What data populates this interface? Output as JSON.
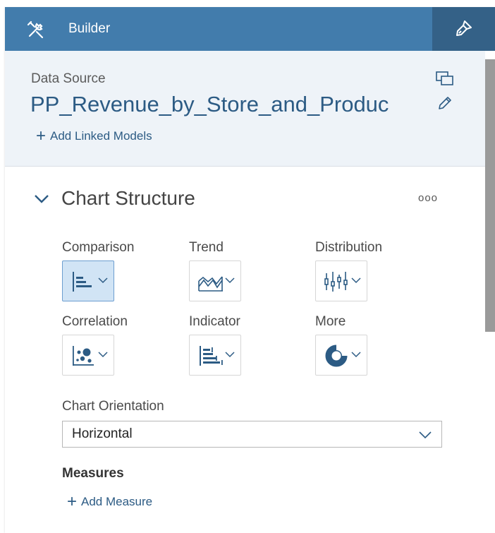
{
  "header": {
    "title": "Builder",
    "builder_icon": "tools-icon",
    "styling_icon": "paintbrush-icon",
    "color": "#427cac",
    "active_tab_color": "#346187"
  },
  "data_source": {
    "label": "Data Source",
    "name": "PP_Revenue_by_Store_and_Produc",
    "add_linked_label": "Add Linked Models",
    "background": "#eef3f8"
  },
  "chart_structure": {
    "title": "Chart Structure",
    "menu_label": "ooo",
    "categories": [
      {
        "label": "Comparison",
        "icon": "bar-chart-icon",
        "selected": true
      },
      {
        "label": "Trend",
        "icon": "area-chart-icon",
        "selected": false
      },
      {
        "label": "Distribution",
        "icon": "boxplot-icon",
        "selected": false
      },
      {
        "label": "Correlation",
        "icon": "bubble-chart-icon",
        "selected": false
      },
      {
        "label": "Indicator",
        "icon": "indicator-bar-icon",
        "selected": false
      },
      {
        "label": "More",
        "icon": "donut-chart-icon",
        "selected": false
      }
    ],
    "orientation_label": "Chart Orientation",
    "orientation_value": "Horizontal",
    "measures_label": "Measures",
    "add_measure_label": "Add Measure"
  }
}
